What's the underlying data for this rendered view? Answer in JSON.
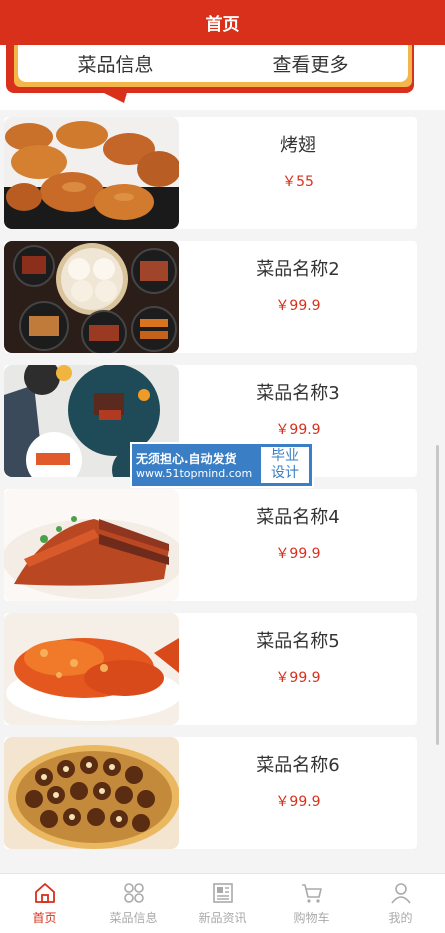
{
  "header": {
    "title": "首页"
  },
  "banner": {
    "left_label": "菜品信息",
    "right_label": "查看更多"
  },
  "dishes": [
    {
      "name": "烤翅",
      "price": "￥55"
    },
    {
      "name": "菜品名称2",
      "price": "￥99.9"
    },
    {
      "name": "菜品名称3",
      "price": "￥99.9"
    },
    {
      "name": "菜品名称4",
      "price": "￥99.9"
    },
    {
      "name": "菜品名称5",
      "price": "￥99.9"
    },
    {
      "name": "菜品名称6",
      "price": "￥99.9"
    }
  ],
  "watermark": {
    "line1": "无须担心.自动发货",
    "line2": "www.51topmind.com",
    "badge_top": "毕业",
    "badge_bottom": "设计"
  },
  "tabbar": {
    "items": [
      {
        "label": "首页",
        "icon": "home-icon",
        "active": true
      },
      {
        "label": "菜品信息",
        "icon": "grid-icon",
        "active": false
      },
      {
        "label": "新品资讯",
        "icon": "news-icon",
        "active": false
      },
      {
        "label": "购物车",
        "icon": "cart-icon",
        "active": false
      },
      {
        "label": "我的",
        "icon": "user-icon",
        "active": false
      }
    ]
  },
  "colors": {
    "primary": "#d8301b",
    "accent": "#f2b64a",
    "watermark": "#3a7ec5"
  }
}
